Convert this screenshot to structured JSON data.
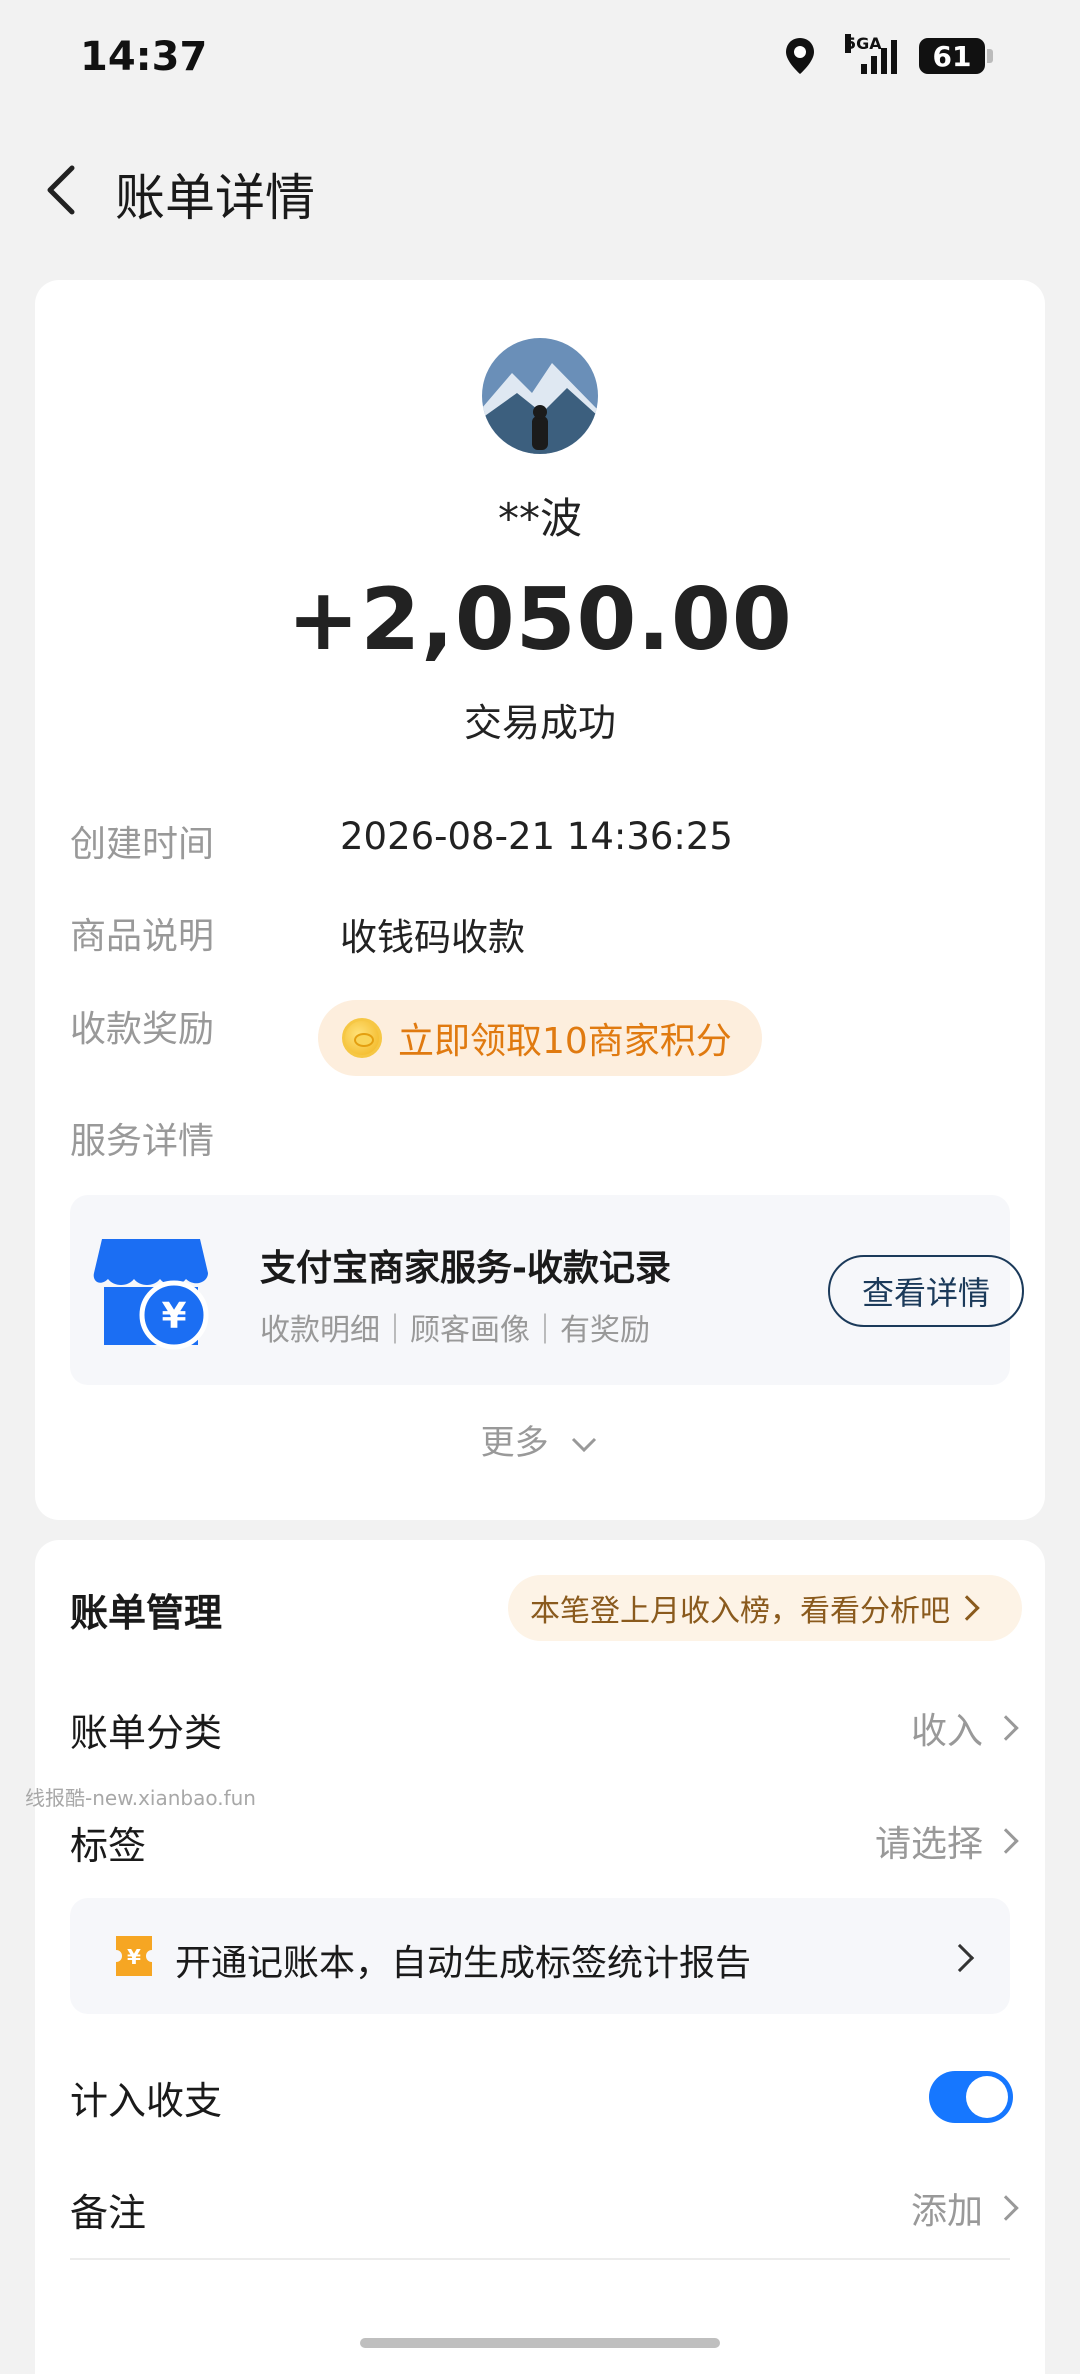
{
  "status_bar": {
    "time": "14:37",
    "network": "5GA",
    "battery": "61"
  },
  "header": {
    "title": "账单详情"
  },
  "transaction": {
    "payer_name": "**波",
    "amount": "+2,050.00",
    "status": "交易成功",
    "created_label": "创建时间",
    "created_value": "2026-08-21 14:36:25",
    "product_label": "商品说明",
    "product_value": "收钱码收款",
    "reward_label": "收款奖励",
    "reward_text": "立即领取10商家积分",
    "service_label": "服务详情",
    "service_title": "支付宝商家服务-收款记录",
    "service_sub": "收款明细｜顾客画像｜有奖励",
    "view_detail": "查看详情",
    "more": "更多"
  },
  "management": {
    "title": "账单管理",
    "analysis": "本笔登上月收入榜，看看分析吧",
    "category_label": "账单分类",
    "category_value": "收入",
    "tag_label": "标签",
    "tag_value": "请选择",
    "promo_text": "开通记账本，自动生成标签统计报告",
    "include_label": "计入收支",
    "include_on": true,
    "note_label": "备注",
    "note_value": "添加"
  },
  "watermark": "线报酷-new.xianbao.fun",
  "colors": {
    "accent": "#1677ff",
    "reward_orange": "#e07a10",
    "shop_blue": "#1b6ef3"
  }
}
